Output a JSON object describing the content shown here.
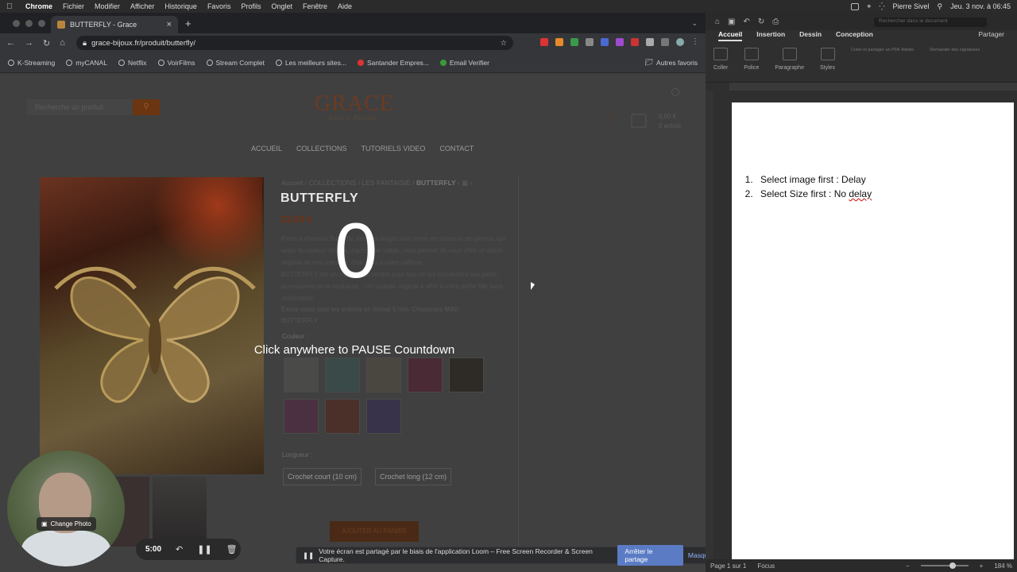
{
  "menubar": {
    "app": "Chrome",
    "items": [
      "Fichier",
      "Modifier",
      "Afficher",
      "Historique",
      "Favoris",
      "Profils",
      "Onglet",
      "Fenêtre",
      "Aide"
    ],
    "user": "Pierre Sivel",
    "datetime": "Jeu. 3 nov. à 06:45"
  },
  "browser": {
    "tab_title": "BUTTERFLY - Grace",
    "url": "grace-bijoux.fr/produit/butterfly/",
    "bookmarks": [
      "K-Streaming",
      "myCANAL",
      "Netflix",
      "VoirFilms",
      "Stream Complet",
      "Les meilleurs sites...",
      "Santander Empres...",
      "Email Verifier"
    ],
    "other_bookmarks": "Autres favoris"
  },
  "site": {
    "search_placeholder": "Recherche un produit",
    "logo": "GRACE",
    "logo_sub": "Grace Bijoux",
    "cart_total": "0,00 €",
    "cart_items": "0 article",
    "nav": [
      "ACCUEIL",
      "COLLECTIONS",
      "TUTORIELS VIDEO",
      "CONTACT"
    ],
    "breadcrumb": "Accueil / COLLECTIONS / LES FANTAISIE /",
    "breadcrumb_current": "BUTTERFLY",
    "product_title": "BUTTERFLY",
    "price": "23,00 €",
    "desc1": "Pince à cheveux Butterfly, dont les doigts sont ornés de strass et de pierres, qui, selon la couleur choisie, s'accroche solide, vous permet de vous offrir un décor original de vos cheveux, d'un tissu à votre coiffure.",
    "desc2": "BUTTERFLY est un modèle qui rendra pour tout ce qui conviendra vos petits accessoires de la tendance... Un cadeau original à offrir à votre petite fille sans modération.",
    "exist": "Existe aussi pour les enfants en format 5 mm. Choisissez MINI BUTTERFLY",
    "color_label": "Couleur :",
    "length_label": "Longueur :",
    "size_short": "Crochet court (10 cm)",
    "size_long": "Crochet long (12 cm)",
    "add_to_cart": "AJOUTER AU PANIER"
  },
  "overlay": {
    "countdown": "0",
    "pause_text": "Click anywhere to PAUSE Countdown"
  },
  "loom": {
    "change_photo": "Change Photo",
    "timer": "5:00",
    "share_text": "Votre écran est partagé par le biais de l'application Loom – Free Screen Recorder & Screen Capture.",
    "stop_share": "Arrêter le partage",
    "hide": "Masquer"
  },
  "word": {
    "search_placeholder": "Rechercher dans le document",
    "tabs": [
      "Accueil",
      "Insertion",
      "Dessin",
      "Conception"
    ],
    "share": "Partager",
    "ribbon": [
      "Coller",
      "Police",
      "Paragraphe",
      "Styles",
      "Créer et partager un PDF Adobe",
      "Demander des signatures"
    ],
    "list": [
      {
        "text": "Select image first : Delay"
      },
      {
        "pre": "Select Size first : No ",
        "flagged": "delay"
      }
    ],
    "status_page": "Page 1 sur 1",
    "status_focus": "Focus",
    "zoom": "184 %"
  }
}
